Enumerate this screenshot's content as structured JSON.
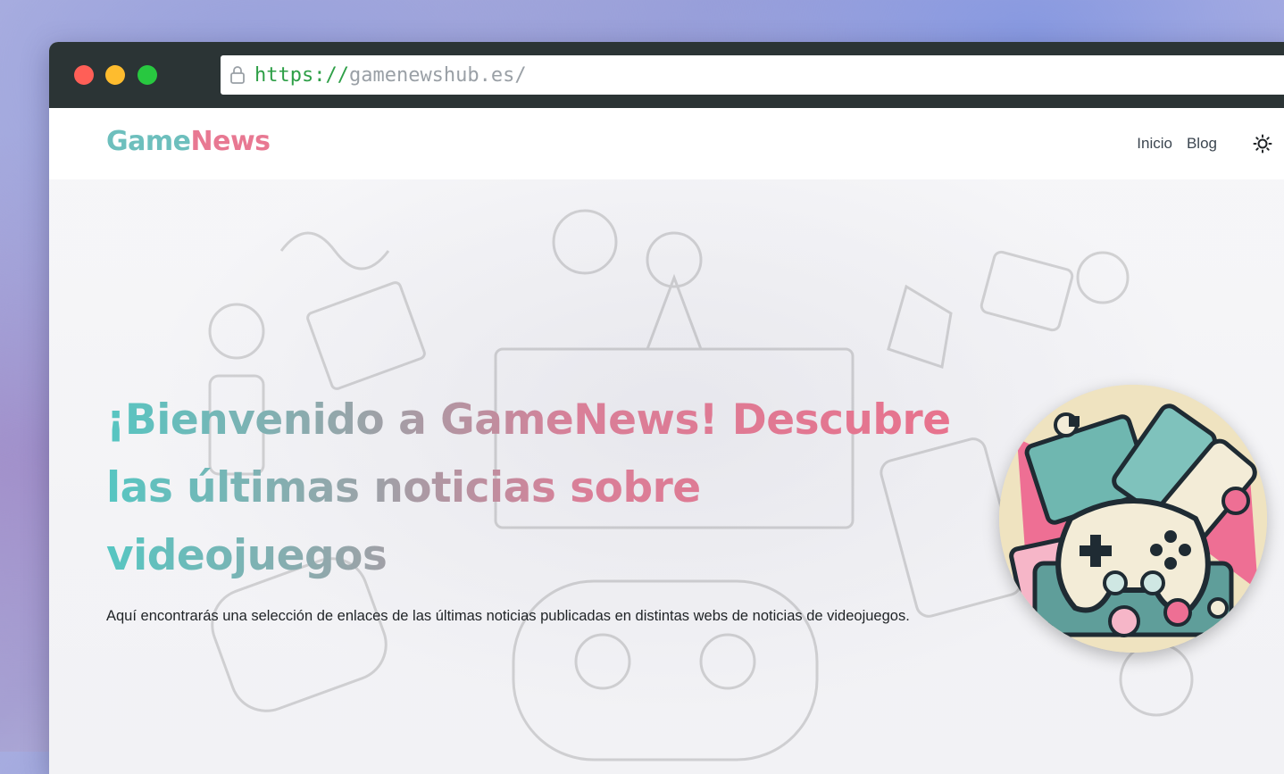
{
  "browser": {
    "url_protocol": "https://",
    "url_host": "gamenewshub.es/"
  },
  "nav": {
    "logo_part1": "Game",
    "logo_part2": "News",
    "links": [
      "Inicio",
      "Blog"
    ],
    "theme_icon": "sun-icon"
  },
  "hero": {
    "headline": "¡Bienvenido a GameNews! Descubre las últimas noticias sobre videojuegos",
    "subtitle": "Aquí encontrarás una selección de enlaces de las últimas noticias publicadas en distintas webs de noticias de videojuegos.",
    "image_icon": "gamepad-illustration"
  },
  "colors": {
    "teal": "#6dbfbd",
    "pink": "#e87892",
    "titlebar": "#2b3435",
    "url_green": "#2e9f47"
  }
}
